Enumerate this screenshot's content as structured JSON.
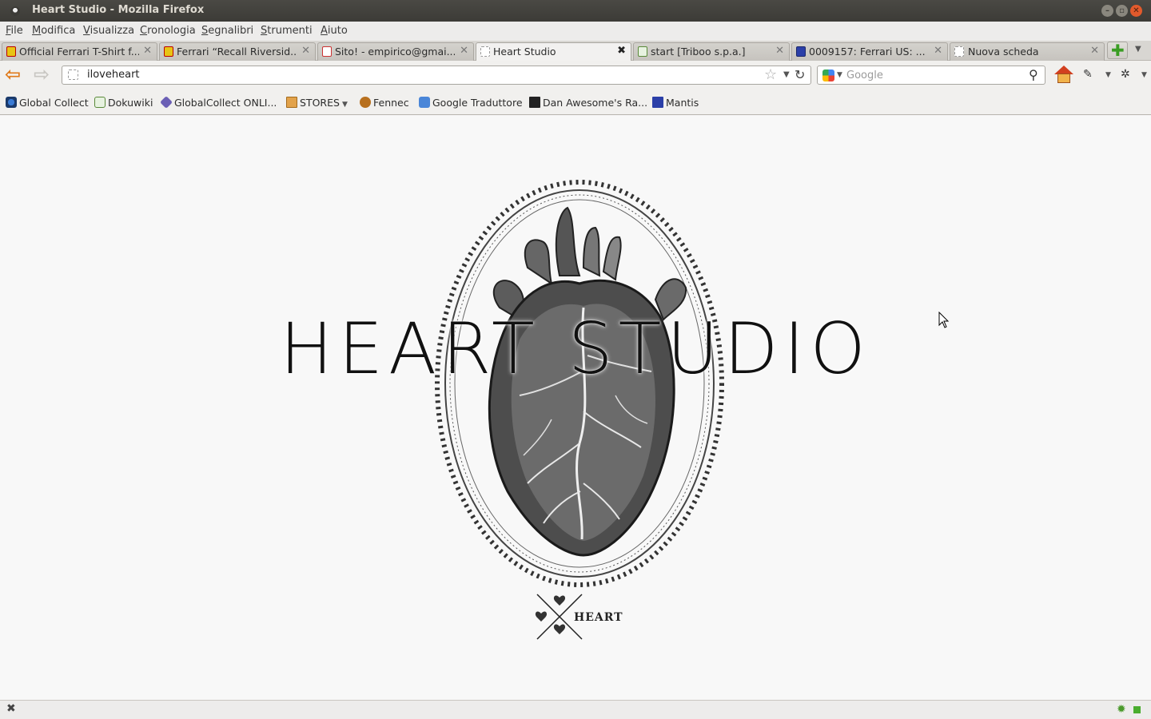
{
  "window": {
    "title": "Heart Studio - Mozilla Firefox"
  },
  "menu": [
    "File",
    "Modifica",
    "Visualizza",
    "Cronologia",
    "Segnalibri",
    "Strumenti",
    "Aiuto"
  ],
  "tabs": [
    {
      "label": "Official Ferrari T-Shirt f...",
      "icon": "ferrari-icon",
      "active": false
    },
    {
      "label": "Ferrari “Recall Riversid...",
      "icon": "ferrari-icon",
      "active": false
    },
    {
      "label": "Sito! - empirico@gmai...",
      "icon": "gmail-icon",
      "active": false
    },
    {
      "label": "Heart Studio",
      "icon": "blank-page-icon",
      "active": true
    },
    {
      "label": "start [Triboo s.p.a.]",
      "icon": "dokuwiki-icon",
      "active": false
    },
    {
      "label": "0009157: Ferrari US: ...",
      "icon": "mantis-icon",
      "active": false
    },
    {
      "label": "Nuova scheda",
      "icon": "blank-page-icon",
      "active": false
    }
  ],
  "navigation": {
    "url": "iloveheart",
    "search_placeholder": "Google"
  },
  "bookmarks": [
    {
      "label": "Global Collect",
      "icon": "globalcollect-icon"
    },
    {
      "label": "Dokuwiki",
      "icon": "dokuwiki-icon"
    },
    {
      "label": "GlobalCollect ONLI...",
      "icon": "globalcollect-online-icon"
    },
    {
      "label": "STORES",
      "icon": "folder-icon",
      "dropdown": true
    },
    {
      "label": "Fennec",
      "icon": "fennec-icon"
    },
    {
      "label": "Google Traduttore",
      "icon": "google-translate-icon"
    },
    {
      "label": "Dan Awesome's Ra...",
      "icon": "dan-awesome-icon"
    },
    {
      "label": "Mantis",
      "icon": "mantis-icon"
    }
  ],
  "page": {
    "brand_title": "HEART STUDIO",
    "logo_word": "HEART"
  },
  "colors": {
    "titlebar": "#3c3b37",
    "accent_back": "#e07a1b",
    "close_button": "#e25a2c"
  }
}
